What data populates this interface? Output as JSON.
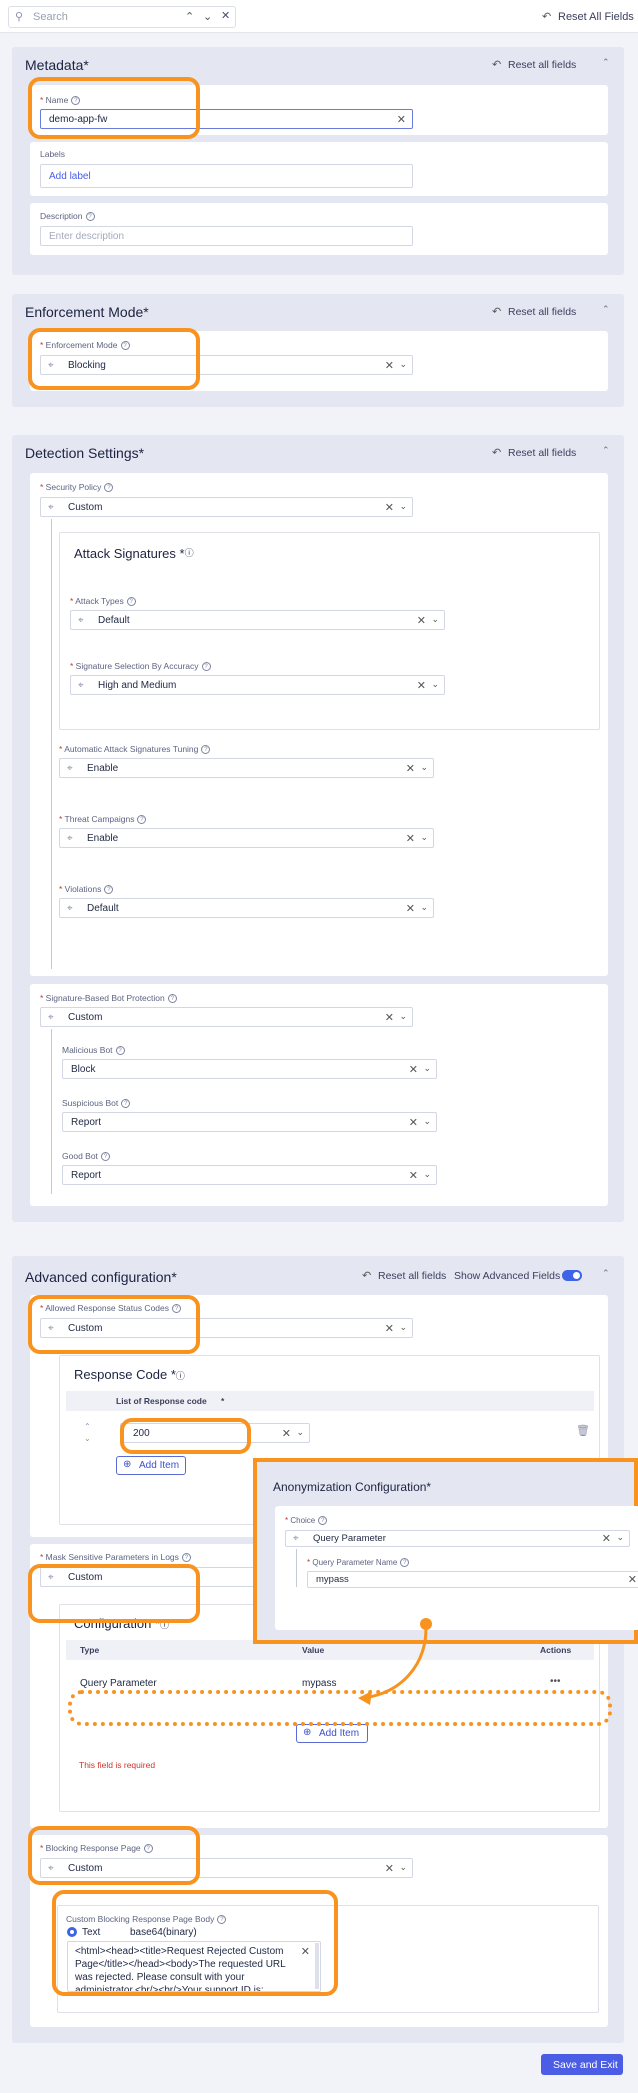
{
  "topbar": {
    "search_placeholder": "Search",
    "reset_all": "Reset All Fields"
  },
  "metadata": {
    "title": "Metadata",
    "reset": "Reset all fields",
    "name_label": "Name",
    "name_value": "demo-app-fw",
    "labels_label": "Labels",
    "add_label": "Add label",
    "description_label": "Description",
    "description_placeholder": "Enter description"
  },
  "enforcement": {
    "title": "Enforcement Mode",
    "reset": "Reset all fields",
    "label": "Enforcement Mode",
    "value": "Blocking"
  },
  "detection": {
    "title": "Detection Settings",
    "reset": "Reset all fields",
    "security_policy_label": "Security Policy",
    "security_policy_value": "Custom",
    "attack_sig_title": "Attack Signatures",
    "attack_types_label": "Attack Types",
    "attack_types_value": "Default",
    "sig_selection_label": "Signature Selection By Accuracy",
    "sig_selection_value": "High and Medium",
    "auto_tuning_label": "Automatic Attack Signatures Tuning",
    "auto_tuning_value": "Enable",
    "threat_label": "Threat Campaigns",
    "threat_value": "Enable",
    "violations_label": "Violations",
    "violations_value": "Default",
    "bot_label": "Signature-Based Bot Protection",
    "bot_value": "Custom",
    "malicious_label": "Malicious Bot",
    "malicious_value": "Block",
    "suspicious_label": "Suspicious Bot",
    "suspicious_value": "Report",
    "good_label": "Good Bot",
    "good_value": "Report"
  },
  "advanced": {
    "title": "Advanced configuration",
    "reset": "Reset all fields",
    "show_advanced": "Show Advanced Fields",
    "show_advanced_on": true,
    "allowed_codes_label": "Allowed Response Status Codes",
    "allowed_codes_value": "Custom",
    "response_code_title": "Response Code",
    "list_header": "List of Response code",
    "code_value": "200",
    "add_item": "Add Item",
    "mask_label": "Mask Sensitive Parameters in Logs",
    "mask_value": "Custom",
    "config_title": "Configuration",
    "col_type": "Type",
    "col_value": "Value",
    "col_actions": "Actions",
    "row_type": "Query Parameter",
    "row_value": "mypass",
    "row_actions": "•••",
    "add_item2": "Add Item",
    "required_msg": "This field is required",
    "blocking_label": "Blocking Response Page",
    "blocking_value": "Custom",
    "body_label": "Custom Blocking Response Page Body",
    "radio_text": "Text",
    "radio_b64": "base64(binary)",
    "body_value": "<html><head><title>Request Rejected Custom Page</title></head><body>The requested URL was rejected. Please consult with your administrator.<br/><br/>Your support ID is:"
  },
  "popup": {
    "title": "Anonymization Configuration",
    "choice_label": "Choice",
    "choice_value": "Query Parameter",
    "qp_label": "Query Parameter Name",
    "qp_value": "mypass"
  },
  "footer": {
    "save": "Save and Exit"
  },
  "colors": {
    "accent": "#4b5de4",
    "highlight": "#f7931e"
  }
}
